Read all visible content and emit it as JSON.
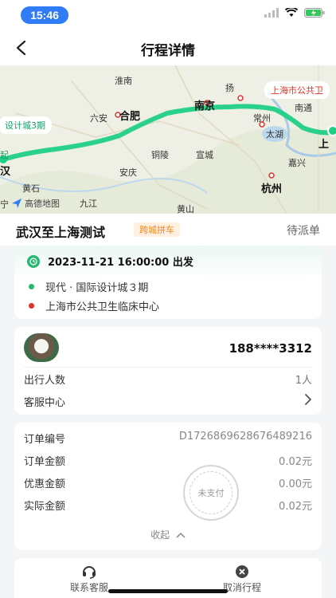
{
  "status_bar": {
    "time": "15:46"
  },
  "nav": {
    "title": "行程详情"
  },
  "map": {
    "start_tag": "设计城3期",
    "end_tag": "上海市公共卫",
    "logo_text": "高德地图",
    "places": {
      "huainan": "淮南",
      "yangzhou": "扬",
      "nanjing": "南京",
      "nantong": "南通",
      "hefei": "合肥",
      "liuan": "六安",
      "changzhou": "常州",
      "taihu": "太湖",
      "shanghai_right": "上",
      "tongling": "铜陵",
      "xuancheng": "宣城",
      "anqing": "安庆",
      "jiaxing": "嘉兴",
      "huangshi": "黄石",
      "hangzhou": "杭州",
      "wuhan_edge": "汉",
      "jiujiang": "九江",
      "huangshan": "黄山",
      "ning": "宁",
      "qi": "起"
    }
  },
  "trip": {
    "title": "武汉至上海测试",
    "badge": "跨城拼车",
    "status": "待派单"
  },
  "route": {
    "depart_time": "2023-11-21 16:00:00 出发",
    "start": "现代 · 国际设计城３期",
    "end": "上海市公共卫生临床中心"
  },
  "driver": {
    "phone": "188****3312",
    "passengers_label": "出行人数",
    "passengers_value": "1人",
    "service_label": "客服中心"
  },
  "order": {
    "number_label": "订单编号",
    "number_value": "D1726869628676489216",
    "amount_label": "订单金额",
    "amount_value": "0.02元",
    "discount_label": "优惠金额",
    "discount_value": "0.00元",
    "actual_label": "实际金额",
    "actual_value": "0.02元",
    "stamp_text": "未支付",
    "collapse_label": "收起"
  },
  "bottom": {
    "contact_label": "联系客服",
    "cancel_label": "取消行程"
  },
  "colors": {
    "accent": "#2bb673",
    "route_line": "#1fcf86",
    "end_marker": "#e0322a",
    "badge": "#f08a1e"
  }
}
